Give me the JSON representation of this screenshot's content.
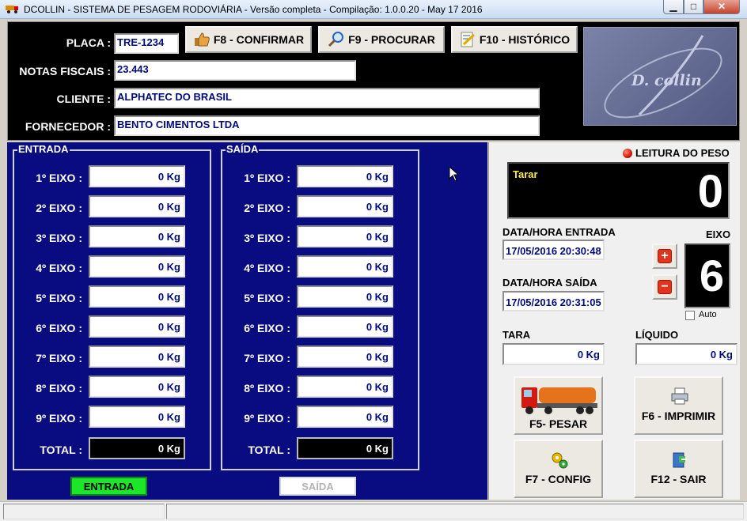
{
  "window": {
    "title": "DCOLLIN - SISTEMA DE PESAGEM RODOVIÁRIA - Versão completa - Compilação: 1.0.0.20 - May 17 2016",
    "controls": {
      "minimize": "▁",
      "maximize": "□",
      "close": "✕"
    }
  },
  "header": {
    "placa_label": "PLACA :",
    "placa_value": "TRE-1234",
    "notas_label": "NOTAS FISCAIS :",
    "notas_value": "23.443",
    "cliente_label": "CLIENTE :",
    "cliente_value": "ALPHATEC DO BRASIL",
    "fornecedor_label": "FORNECEDOR :",
    "fornecedor_value": "BENTO CIMENTOS LTDA",
    "buttons": {
      "confirmar": "F8 - CONFIRMAR",
      "procurar": "F9 - PROCURAR",
      "historico": "F10 - HISTÓRICO"
    },
    "logo_text": "D. collin"
  },
  "entrada": {
    "title": "ENTRADA",
    "axles": [
      {
        "label": "1º EIXO :",
        "value": "0 Kg"
      },
      {
        "label": "2º EIXO :",
        "value": "0 Kg"
      },
      {
        "label": "3º EIXO :",
        "value": "0 Kg"
      },
      {
        "label": "4º EIXO :",
        "value": "0 Kg"
      },
      {
        "label": "5º EIXO :",
        "value": "0 Kg"
      },
      {
        "label": "6º EIXO :",
        "value": "0 Kg"
      },
      {
        "label": "7º EIXO :",
        "value": "0 Kg"
      },
      {
        "label": "8º EIXO :",
        "value": "0 Kg"
      },
      {
        "label": "9º EIXO :",
        "value": "0 Kg"
      }
    ],
    "total_label": "TOTAL :",
    "total_value": "0 Kg",
    "status_button": "ENTRADA"
  },
  "saida": {
    "title": "SAÍDA",
    "axles": [
      {
        "label": "1º EIXO :",
        "value": "0 Kg"
      },
      {
        "label": "2º EIXO :",
        "value": "0 Kg"
      },
      {
        "label": "3º EIXO :",
        "value": "0 Kg"
      },
      {
        "label": "4º EIXO :",
        "value": "0 Kg"
      },
      {
        "label": "5º EIXO :",
        "value": "0 Kg"
      },
      {
        "label": "6º EIXO :",
        "value": "0 Kg"
      },
      {
        "label": "7º EIXO :",
        "value": "0 Kg"
      },
      {
        "label": "8º EIXO :",
        "value": "0 Kg"
      },
      {
        "label": "9º EIXO :",
        "value": "0 Kg"
      }
    ],
    "total_label": "TOTAL :",
    "total_value": "0 Kg",
    "status_button": "SAÍDA"
  },
  "right": {
    "leitura_label": "LEITURA DO PESO",
    "display_mode": "Tarar",
    "display_value": "0",
    "entrada_dt_label": "DATA/HORA ENTRADA",
    "entrada_dt_value": "17/05/2016 20:30:48",
    "saida_dt_label": "DATA/HORA SAÍDA",
    "saida_dt_value": "17/05/2016 20:31:05",
    "eixo_label": "EIXO",
    "eixo_value": "6",
    "plus": "+",
    "minus": "−",
    "auto_label": "Auto",
    "tara_label": "TARA",
    "tara_value": "0 Kg",
    "liquido_label": "LÍQUIDO",
    "liquido_value": "0 Kg",
    "buttons": {
      "pesar": "F5- PESAR",
      "imprimir": "F6 - IMPRIMIR",
      "config": "F7 - CONFIG",
      "sair": "F12 - SAIR"
    }
  },
  "colors": {
    "panel_blue": "#080c80",
    "active_green": "#1de52a",
    "field_text": "#000b7a",
    "led_red": "#d01800"
  }
}
